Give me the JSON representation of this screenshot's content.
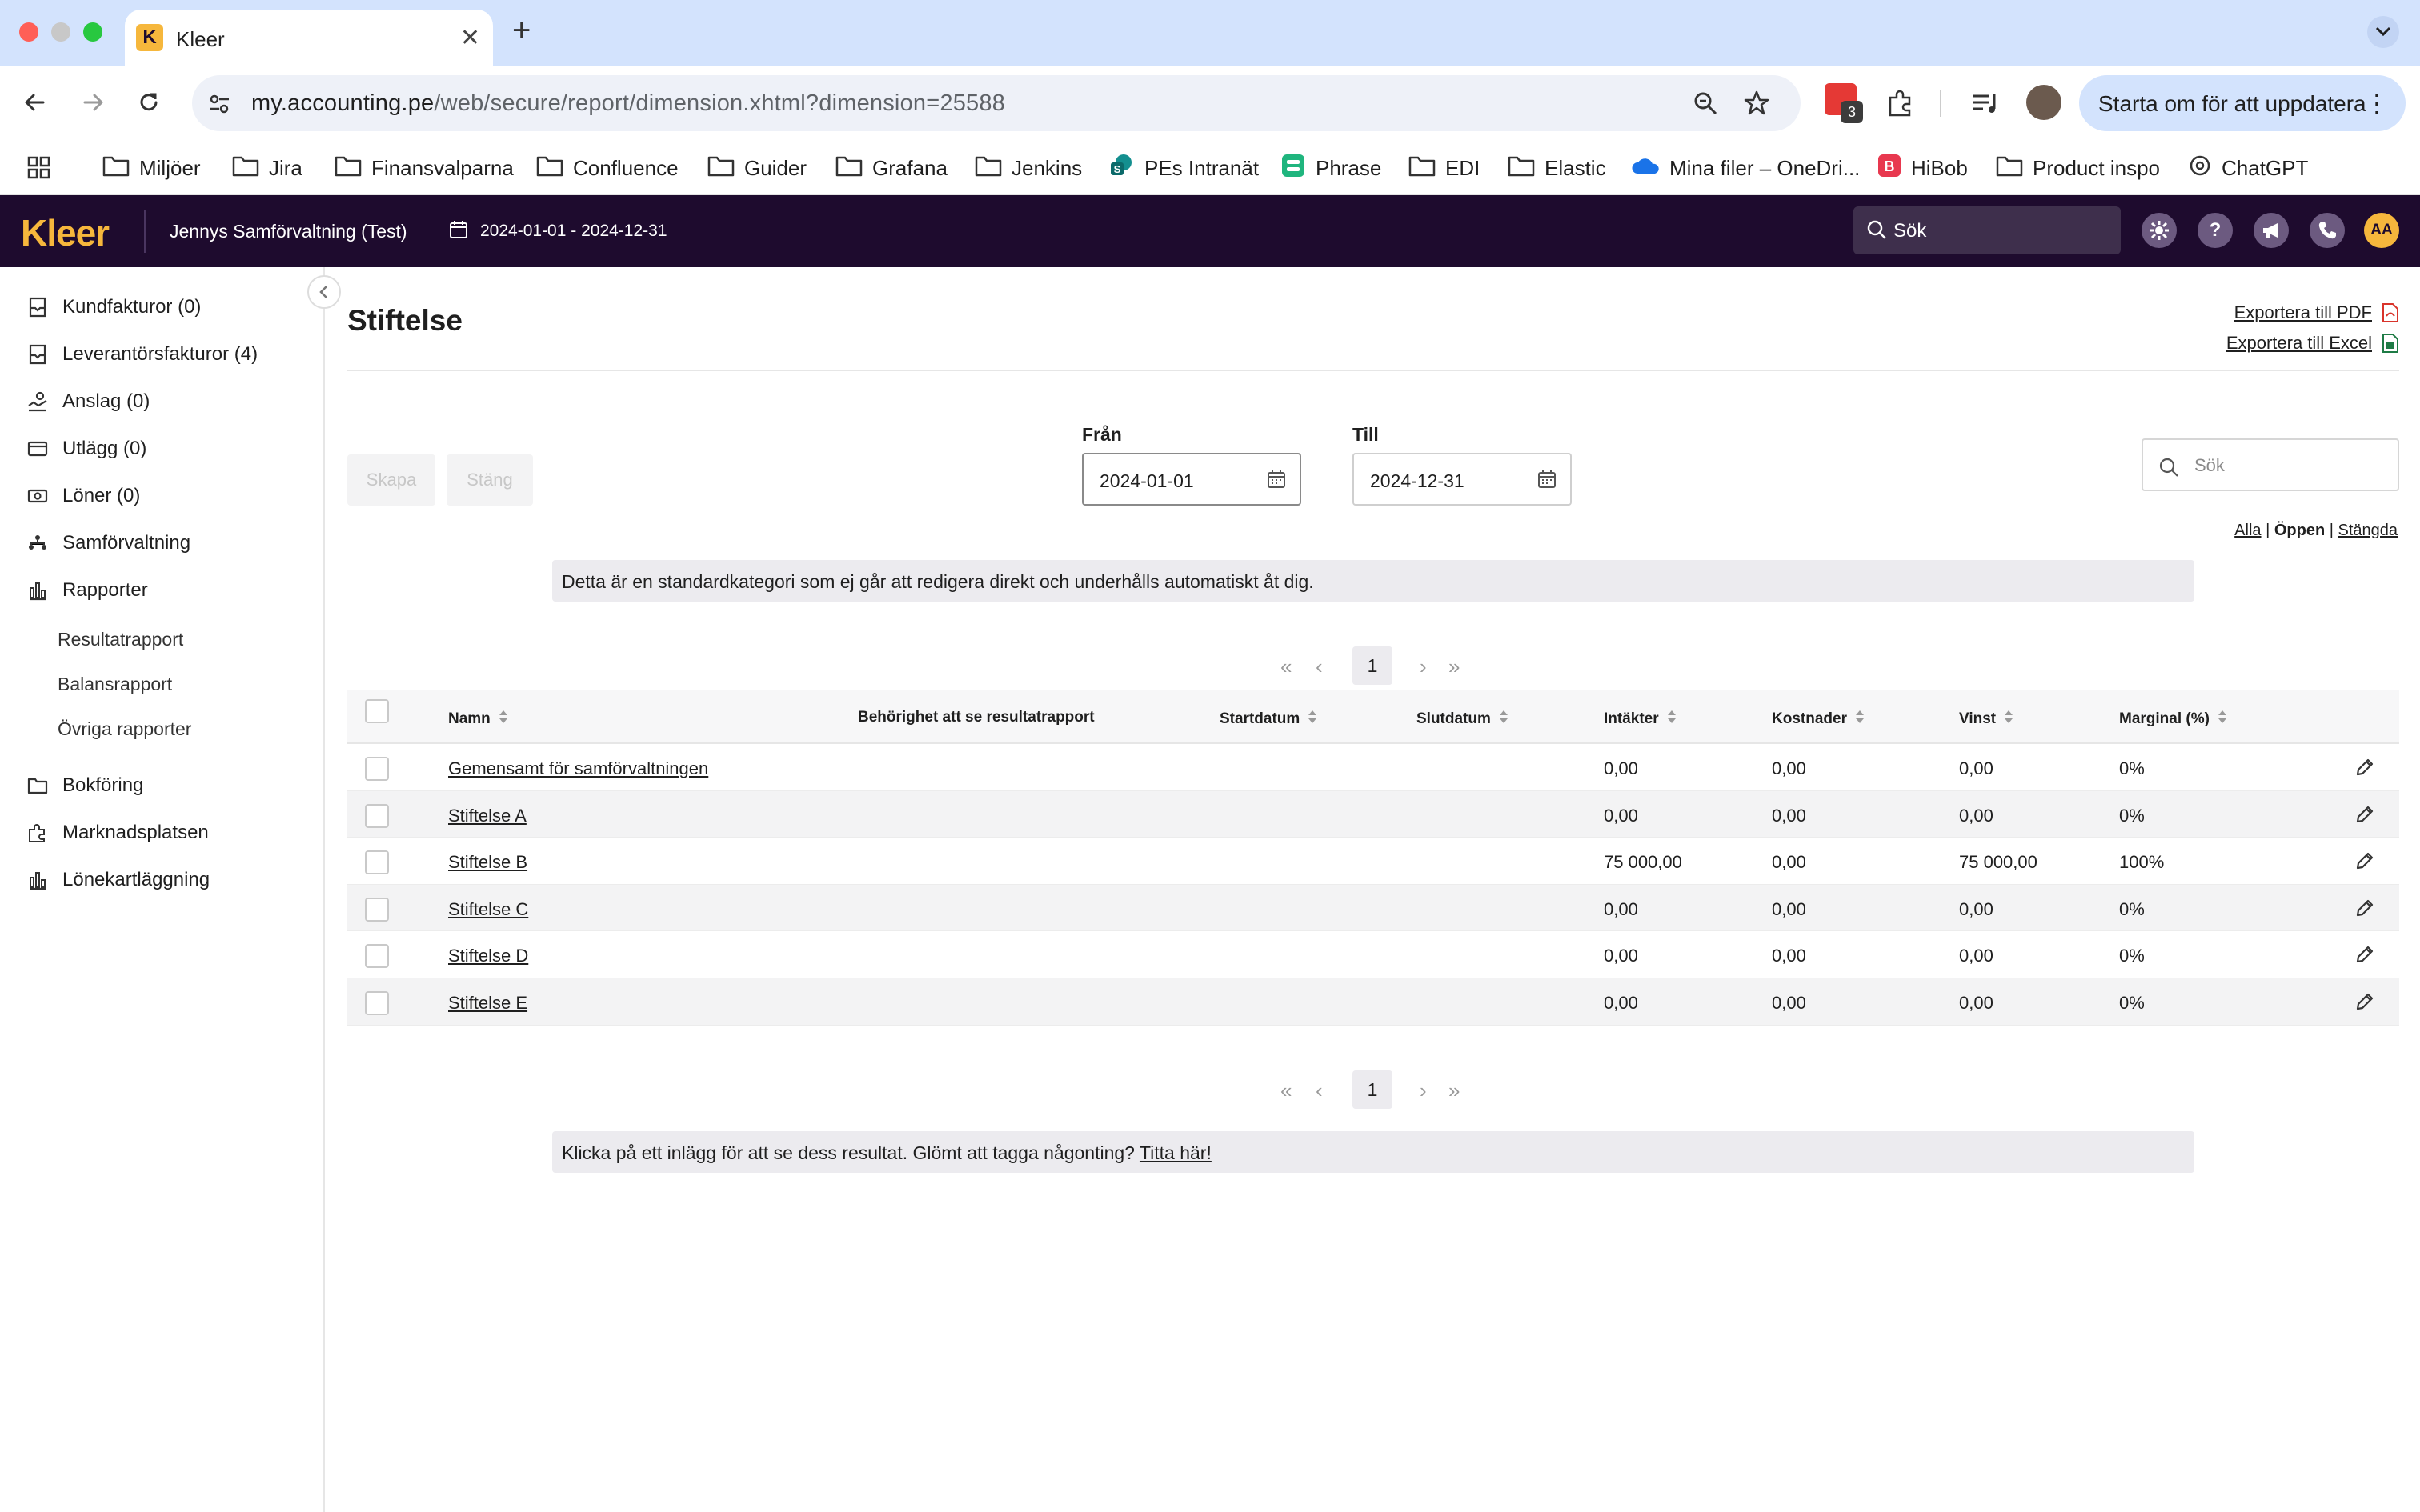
{
  "browser": {
    "tab_title": "Kleer",
    "tab_favicon_letter": "K",
    "url_host": "my.accounting.pe",
    "url_path": "/web/secure/report/dimension.xhtml?dimension=25588",
    "extension_badge": "3",
    "update_button": "Starta om för att uppdatera",
    "bookmarks": [
      "Miljöer",
      "Jira",
      "Finansvalparna",
      "Confluence",
      "Guider",
      "Grafana",
      "Jenkins",
      "PEs Intranät",
      "Phrase",
      "EDI",
      "Elastic",
      "Mina filer – OneDri...",
      "HiBob",
      "Product inspo",
      "ChatGPT"
    ]
  },
  "header": {
    "logo": "Kleer",
    "company": "Jennys Samförvaltning (Test)",
    "period": "2024-01-01 - 2024-12-31",
    "search_placeholder": "Sök",
    "avatar_initials": "AA"
  },
  "sidebar": {
    "items": [
      {
        "label": "Kundfakturor  (0)",
        "icon": "invoice-icon"
      },
      {
        "label": "Leverantörsfakturor  (4)",
        "icon": "invoice-icon"
      },
      {
        "label": "Anslag  (0)",
        "icon": "grant-icon"
      },
      {
        "label": "Utlägg  (0)",
        "icon": "card-icon"
      },
      {
        "label": "Löner  (0)",
        "icon": "money-icon"
      },
      {
        "label": "Samförvaltning",
        "icon": "org-icon"
      },
      {
        "label": "Rapporter",
        "icon": "chart-icon"
      }
    ],
    "sub_items": [
      "Resultatrapport",
      "Balansrapport",
      "Övriga rapporter"
    ],
    "items_bottom": [
      {
        "label": "Bokföring",
        "icon": "folder-icon"
      },
      {
        "label": "Marknadsplatsen",
        "icon": "puzzle-icon"
      },
      {
        "label": "Lönekartläggning",
        "icon": "chart-icon"
      }
    ]
  },
  "main": {
    "title": "Stiftelse",
    "export_pdf": "Exportera till PDF",
    "export_excel": "Exportera till Excel",
    "create_label": "Skapa",
    "close_label": "Stäng",
    "from_label": "Från",
    "from_value": "2024-01-01",
    "to_label": "Till",
    "to_value": "2024-12-31",
    "search_placeholder": "Sök",
    "filters": {
      "all": "Alla",
      "open": "Öppen",
      "closed": "Stängda"
    },
    "info_text": "Detta är en standardkategori som ej går att redigera direkt och underhålls automatiskt åt dig.",
    "pager_current": "1",
    "footer_text": "Klicka på ett inlägg för att se dess resultat. Glömt att tagga någonting? ",
    "footer_link": "Titta här!"
  },
  "table": {
    "columns": [
      "Namn",
      "Behörighet att se resultatrapport",
      "Startdatum",
      "Slutdatum",
      "Intäkter",
      "Kostnader",
      "Vinst",
      "Marginal (%)"
    ],
    "rows": [
      {
        "name": "Gemensamt för samförvaltningen",
        "income": "0,00",
        "costs": "0,00",
        "profit": "0,00",
        "margin": "0%"
      },
      {
        "name": "Stiftelse A",
        "income": "0,00",
        "costs": "0,00",
        "profit": "0,00",
        "margin": "0%"
      },
      {
        "name": "Stiftelse B",
        "income": "75 000,00",
        "costs": "0,00",
        "profit": "75 000,00",
        "margin": "100%"
      },
      {
        "name": "Stiftelse C",
        "income": "0,00",
        "costs": "0,00",
        "profit": "0,00",
        "margin": "0%"
      },
      {
        "name": "Stiftelse D",
        "income": "0,00",
        "costs": "0,00",
        "profit": "0,00",
        "margin": "0%"
      },
      {
        "name": "Stiftelse E",
        "income": "0,00",
        "costs": "0,00",
        "profit": "0,00",
        "margin": "0%"
      }
    ]
  },
  "colors": {
    "header_bg": "#1e0b2e",
    "brand_accent": "#f6b73c",
    "tabbar_bg": "#d3e3fd"
  }
}
